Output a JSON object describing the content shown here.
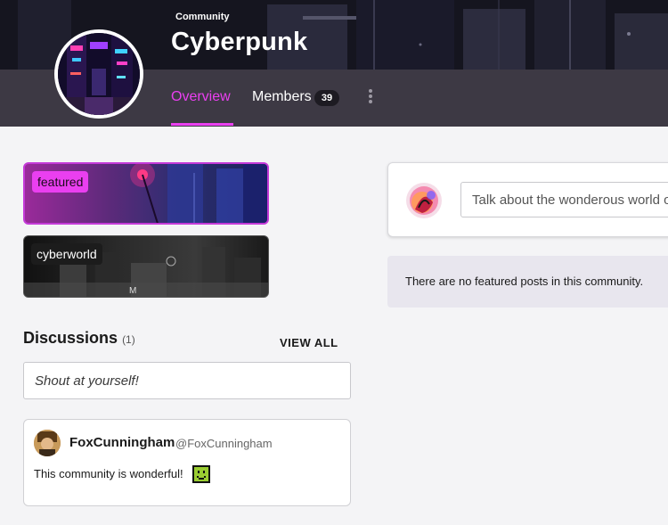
{
  "header": {
    "community_label": "Community",
    "title": "Cyberpunk",
    "accent_color": "#ea3ff0"
  },
  "tabs": {
    "overview": "Overview",
    "members": "Members",
    "members_count": "39",
    "more_icon": "vertical-ellipsis-icon"
  },
  "tags": [
    {
      "label": "featured",
      "selected": true
    },
    {
      "label": "cyberworld",
      "selected": false
    }
  ],
  "discussions": {
    "title": "Discussions",
    "count": "(1)",
    "view_all": "VIEW ALL",
    "shout_placeholder": "Shout at yourself!",
    "posts": [
      {
        "author": "FoxCunningham",
        "handle": "@FoxCunningham",
        "body": "This community is wonderful!",
        "emoji": "green-smiley-icon"
      }
    ]
  },
  "composer": {
    "placeholder": "Talk about the wonderous world of"
  },
  "featured_posts": {
    "empty_message": "There are no featured posts in this community."
  }
}
